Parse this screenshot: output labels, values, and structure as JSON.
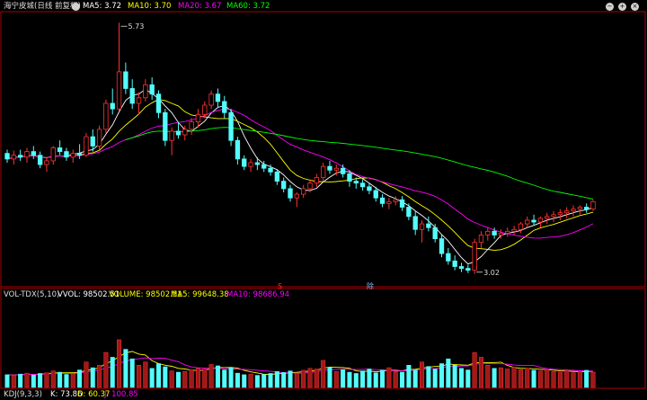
{
  "header": {
    "stock_title": "海宁皮城(日线 前复权)",
    "ma5": "MA5: 3.72",
    "ma10": "MA10: 3.70",
    "ma20": "MA20: 3.67",
    "ma60": "MA60: 3.72"
  },
  "vol_header": {
    "indicator": "VOL-TDX(5,10)",
    "vvol": "VVOL: 98502.51",
    "volume": "VOLUME: 98502.51",
    "ma5": "MA5: 99648.38",
    "ma10": "MA10: 98686.94"
  },
  "kdj_header": {
    "indicator": "KDJ(9,3,3)",
    "k": "K: 73.86",
    "d": "D: 60.37",
    "j": "J: 100.85"
  },
  "controls": {
    "minus": "−",
    "plus": "+",
    "close": "×"
  },
  "markers": {
    "high": "5.73",
    "low": "3.02",
    "event1": "S",
    "event2": "除"
  },
  "colors": {
    "up": "#ff3232",
    "down": "#54fcfc",
    "ma5": "#ffffff",
    "ma10": "#ffff00",
    "ma20": "#ff00ff",
    "ma60": "#00ff00",
    "border": "#aa0000",
    "up_volume_fill": "#a01818"
  },
  "chart_data": [
    {
      "type": "candlestick",
      "title": "海宁皮城(日线 前复权)",
      "ylim": [
        2.95,
        5.8
      ],
      "annotations": [
        {
          "label": "5.73",
          "candle_index": 17,
          "y": 5.73
        },
        {
          "label": "3.02",
          "candle_index": 71,
          "y": 3.02
        }
      ],
      "candles": [
        [
          4.32,
          4.36,
          4.22,
          4.26
        ],
        [
          4.26,
          4.35,
          4.2,
          4.3
        ],
        [
          4.3,
          4.36,
          4.24,
          4.28
        ],
        [
          4.28,
          4.38,
          4.22,
          4.34
        ],
        [
          4.34,
          4.4,
          4.26,
          4.3
        ],
        [
          4.3,
          4.34,
          4.16,
          4.2
        ],
        [
          4.2,
          4.28,
          4.12,
          4.24
        ],
        [
          4.24,
          4.4,
          4.2,
          4.38
        ],
        [
          4.38,
          4.46,
          4.3,
          4.34
        ],
        [
          4.34,
          4.38,
          4.24,
          4.28
        ],
        [
          4.28,
          4.36,
          4.22,
          4.32
        ],
        [
          4.32,
          4.42,
          4.26,
          4.3
        ],
        [
          4.3,
          4.54,
          4.28,
          4.5
        ],
        [
          4.5,
          4.58,
          4.34,
          4.4
        ],
        [
          4.4,
          4.62,
          4.36,
          4.58
        ],
        [
          4.58,
          4.9,
          4.54,
          4.86
        ],
        [
          4.86,
          5.02,
          4.74,
          4.8
        ],
        [
          4.8,
          5.73,
          4.78,
          5.2
        ],
        [
          5.2,
          5.3,
          4.96,
          5.02
        ],
        [
          5.02,
          5.12,
          4.8,
          4.86
        ],
        [
          4.86,
          4.98,
          4.74,
          4.92
        ],
        [
          4.92,
          5.12,
          4.88,
          5.06
        ],
        [
          5.06,
          5.14,
          4.9,
          4.96
        ],
        [
          4.96,
          5.0,
          4.7,
          4.76
        ],
        [
          4.76,
          4.8,
          4.4,
          4.46
        ],
        [
          4.46,
          4.6,
          4.3,
          4.56
        ],
        [
          4.56,
          4.66,
          4.48,
          4.52
        ],
        [
          4.52,
          4.62,
          4.46,
          4.58
        ],
        [
          4.58,
          4.7,
          4.52,
          4.66
        ],
        [
          4.66,
          4.8,
          4.6,
          4.74
        ],
        [
          4.74,
          4.88,
          4.7,
          4.84
        ],
        [
          4.84,
          5.0,
          4.8,
          4.96
        ],
        [
          4.96,
          5.02,
          4.82,
          4.88
        ],
        [
          4.88,
          4.94,
          4.7,
          4.76
        ],
        [
          4.76,
          4.8,
          4.4,
          4.46
        ],
        [
          4.46,
          4.5,
          4.2,
          4.26
        ],
        [
          4.26,
          4.3,
          4.14,
          4.18
        ],
        [
          4.18,
          4.26,
          4.12,
          4.22
        ],
        [
          4.22,
          4.28,
          4.14,
          4.2
        ],
        [
          4.2,
          4.24,
          4.12,
          4.16
        ],
        [
          4.16,
          4.2,
          4.08,
          4.12
        ],
        [
          4.12,
          4.14,
          3.98,
          4.02
        ],
        [
          4.02,
          4.06,
          3.9,
          3.94
        ],
        [
          3.94,
          3.98,
          3.8,
          3.84
        ],
        [
          3.84,
          3.9,
          3.74,
          3.88
        ],
        [
          3.88,
          3.98,
          3.84,
          3.94
        ],
        [
          3.94,
          4.04,
          3.9,
          4.0
        ],
        [
          4.0,
          4.1,
          3.96,
          4.06
        ],
        [
          4.06,
          4.22,
          4.02,
          4.18
        ],
        [
          4.18,
          4.24,
          4.1,
          4.14
        ],
        [
          4.14,
          4.2,
          4.08,
          4.16
        ],
        [
          4.16,
          4.2,
          4.06,
          4.1
        ],
        [
          4.1,
          4.14,
          3.96,
          4.02
        ],
        [
          4.02,
          4.06,
          3.94,
          4.0
        ],
        [
          4.0,
          4.04,
          3.92,
          3.96
        ],
        [
          3.96,
          4.0,
          3.88,
          3.92
        ],
        [
          3.92,
          3.96,
          3.8,
          3.84
        ],
        [
          3.84,
          3.88,
          3.74,
          3.78
        ],
        [
          3.78,
          3.84,
          3.72,
          3.8
        ],
        [
          3.8,
          3.86,
          3.76,
          3.82
        ],
        [
          3.82,
          3.86,
          3.7,
          3.74
        ],
        [
          3.74,
          3.78,
          3.6,
          3.64
        ],
        [
          3.64,
          3.7,
          3.44,
          3.5
        ],
        [
          3.5,
          3.6,
          3.36,
          3.56
        ],
        [
          3.56,
          3.64,
          3.48,
          3.52
        ],
        [
          3.52,
          3.56,
          3.36,
          3.4
        ],
        [
          3.4,
          3.44,
          3.2,
          3.24
        ],
        [
          3.24,
          3.3,
          3.12,
          3.16
        ],
        [
          3.16,
          3.22,
          3.06,
          3.1
        ],
        [
          3.1,
          3.14,
          3.04,
          3.08
        ],
        [
          3.08,
          3.12,
          3.03,
          3.06
        ],
        [
          3.06,
          3.4,
          3.02,
          3.36
        ],
        [
          3.36,
          3.48,
          3.3,
          3.44
        ],
        [
          3.44,
          3.52,
          3.38,
          3.48
        ],
        [
          3.48,
          3.52,
          3.4,
          3.44
        ],
        [
          3.44,
          3.5,
          3.4,
          3.46
        ],
        [
          3.46,
          3.52,
          3.42,
          3.48
        ],
        [
          3.48,
          3.54,
          3.44,
          3.5
        ],
        [
          3.5,
          3.58,
          3.46,
          3.56
        ],
        [
          3.56,
          3.64,
          3.52,
          3.6
        ],
        [
          3.6,
          3.66,
          3.54,
          3.58
        ],
        [
          3.58,
          3.64,
          3.52,
          3.62
        ],
        [
          3.62,
          3.68,
          3.56,
          3.64
        ],
        [
          3.64,
          3.7,
          3.58,
          3.66
        ],
        [
          3.66,
          3.72,
          3.6,
          3.68
        ],
        [
          3.68,
          3.74,
          3.62,
          3.7
        ],
        [
          3.7,
          3.76,
          3.64,
          3.72
        ],
        [
          3.72,
          3.76,
          3.66,
          3.74
        ],
        [
          3.74,
          3.78,
          3.68,
          3.72
        ],
        [
          3.72,
          3.82,
          3.7,
          3.8
        ]
      ]
    },
    {
      "type": "bar",
      "title": "VOL-TDX(5,10)",
      "ylim": [
        0,
        280000
      ],
      "values": [
        40000,
        38000,
        42000,
        45000,
        39000,
        44000,
        46000,
        52000,
        48000,
        41000,
        43000,
        55000,
        80000,
        62000,
        70000,
        110000,
        95000,
        150000,
        120000,
        90000,
        70000,
        80000,
        60000,
        75000,
        65000,
        52000,
        48000,
        50000,
        56000,
        60000,
        58000,
        72000,
        68000,
        55000,
        62000,
        45000,
        40000,
        42000,
        38000,
        41000,
        44000,
        50000,
        47000,
        52000,
        45000,
        54000,
        60000,
        58000,
        85000,
        62000,
        50000,
        56000,
        48000,
        44000,
        52000,
        58000,
        46000,
        54000,
        62000,
        50000,
        48000,
        70000,
        55000,
        80000,
        66000,
        58000,
        75000,
        90000,
        70000,
        60000,
        55000,
        110000,
        95000,
        70000,
        60000,
        62000,
        58000,
        64000,
        56000,
        60000,
        54000,
        52000,
        56000,
        50000,
        48000,
        52000,
        46000,
        50000,
        54000,
        48000
      ]
    }
  ]
}
